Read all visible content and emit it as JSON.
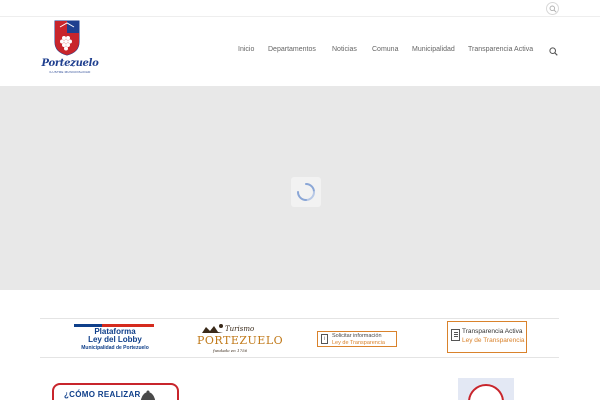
{
  "topbar": {
    "search_icon": "search-icon"
  },
  "header": {
    "logo": {
      "name": "Portezuelo",
      "tagline": "ILUSTRE MUNICIPALIDAD"
    },
    "nav": [
      {
        "label": "Inicio"
      },
      {
        "label": "Departamentos"
      },
      {
        "label": "Noticias"
      },
      {
        "label": "Comuna"
      },
      {
        "label": "Municipalidad"
      },
      {
        "label": "Transparencia Activa"
      }
    ],
    "search_icon": "search-icon"
  },
  "hero": {
    "state": "loading",
    "spinner_icon": "loading-spinner-icon"
  },
  "banners": {
    "lobby": {
      "line1": "Plataforma",
      "line2": "Ley del Lobby",
      "line3": "Municipalidad de Portezuelo"
    },
    "turismo": {
      "small": "Turismo",
      "big": "PORTEZUELO",
      "founded": "fundado en 1756"
    },
    "solicitar": {
      "line1": "Solicitar información",
      "line2": "Ley de Transparencia"
    },
    "transparencia": {
      "line1": "Transparencia Activa",
      "line2": "Ley de Transparencia"
    },
    "row2_left": {
      "text": "¿CÓMO REALIZAR"
    }
  },
  "colors": {
    "brand_blue": "#0f3f8a",
    "brand_red": "#d52b1e",
    "accent_orange": "#d9822b",
    "hero_bg": "#e8e8e8",
    "nav_text": "#666666"
  }
}
